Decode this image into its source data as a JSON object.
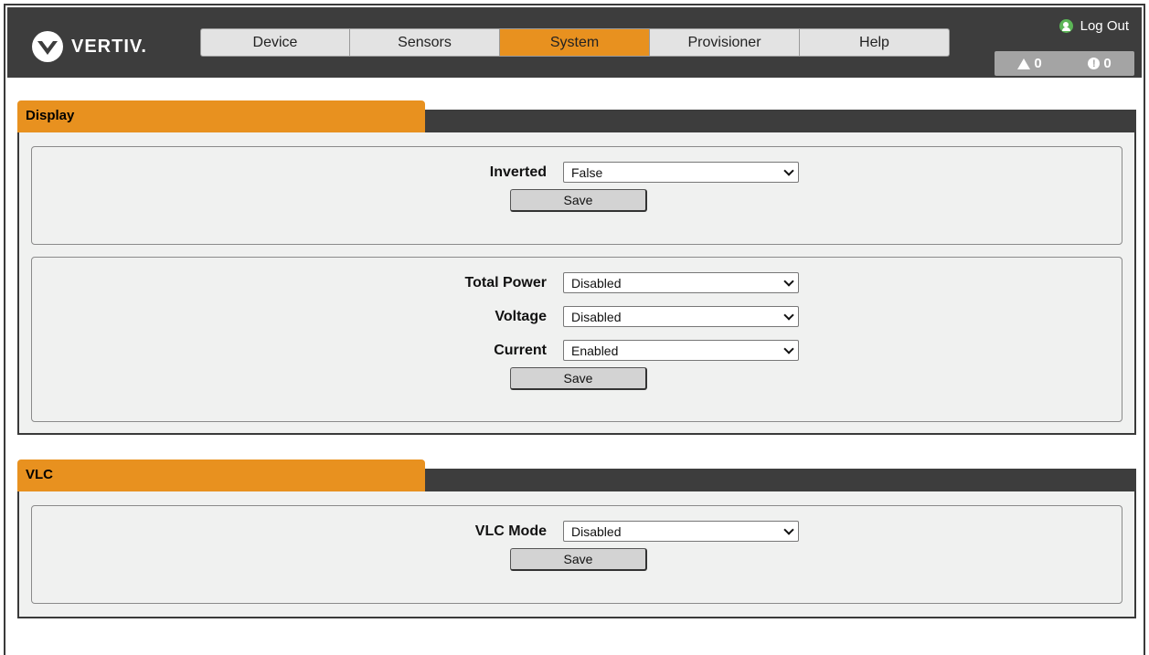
{
  "brand": {
    "name": "VERTIV."
  },
  "nav": {
    "tabs": [
      {
        "label": "Device",
        "active": false
      },
      {
        "label": "Sensors",
        "active": false
      },
      {
        "label": "System",
        "active": true
      },
      {
        "label": "Provisioner",
        "active": false
      },
      {
        "label": "Help",
        "active": false
      }
    ]
  },
  "header": {
    "logout_label": "Log Out",
    "warnings": "0",
    "alarms": "0"
  },
  "colors": {
    "accent": "#e8911f",
    "bar": "#3d3d3d",
    "panel": "#f0f1f0"
  },
  "display": {
    "title": "Display",
    "inverted": {
      "label": "Inverted",
      "value": "False"
    },
    "save1": "Save",
    "total_power": {
      "label": "Total Power",
      "value": "Disabled"
    },
    "voltage": {
      "label": "Voltage",
      "value": "Disabled"
    },
    "current": {
      "label": "Current",
      "value": "Enabled"
    },
    "save2": "Save"
  },
  "vlc": {
    "title": "VLC",
    "mode": {
      "label": "VLC Mode",
      "value": "Disabled"
    },
    "save": "Save"
  }
}
